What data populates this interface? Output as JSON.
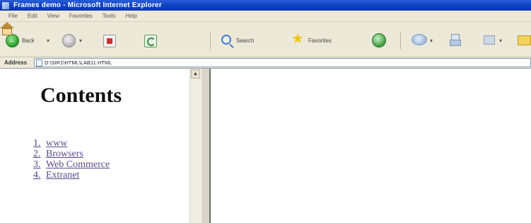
{
  "window": {
    "title": "Frames demo - Microsoft Internet Explorer",
    "title_bar_color": "#0b36b5"
  },
  "menu": {
    "items": [
      "File",
      "Edit",
      "View",
      "Favorites",
      "Tools",
      "Help"
    ]
  },
  "toolbar": {
    "back_label": "Back",
    "back_arrow": "←",
    "forward_arrow": "→",
    "search_label": "Search",
    "favorites_label": "Favorites",
    "star_glyph": "★",
    "dropdown_glyph": "▾",
    "icons": [
      "back-icon",
      "forward-icon",
      "stop-icon",
      "refresh-icon",
      "home-icon",
      "search-icon",
      "favorites-icon",
      "media-icon",
      "mail-icon",
      "print-icon",
      "edit-icon",
      "folder-icon"
    ]
  },
  "address": {
    "label": "Address",
    "value": "D:\\SIR1\\HTML\\LAB11.HTML"
  },
  "left_frame": {
    "heading": "Contents",
    "items": [
      {
        "num": "1.",
        "label": "www"
      },
      {
        "num": "2.",
        "label": "Browsers"
      },
      {
        "num": "3.",
        "label": "Web Commerce"
      },
      {
        "num": "4.",
        "label": "Extranet"
      }
    ],
    "link_color": "#5a4a8a"
  },
  "scrollbar": {
    "up_arrow": "▲"
  }
}
